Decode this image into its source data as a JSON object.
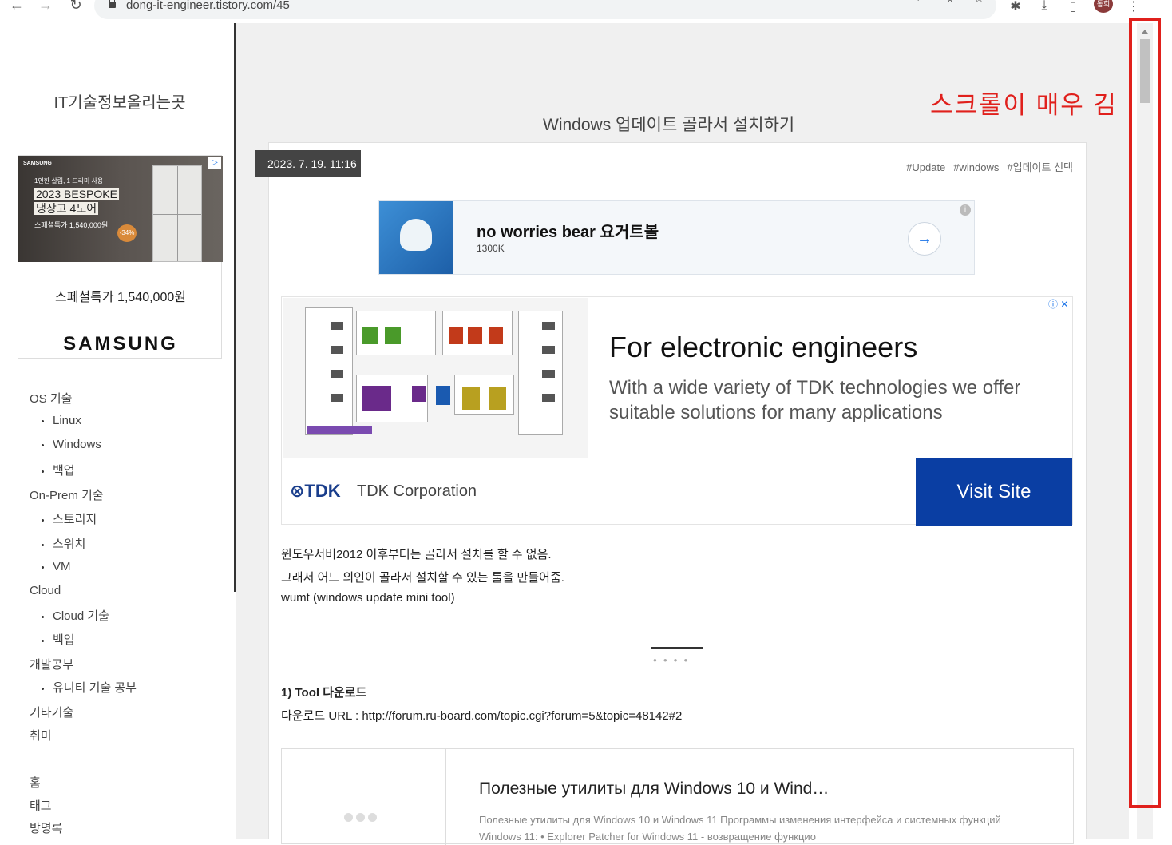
{
  "browser": {
    "url": "dong-it-engineer.tistory.com/45",
    "avatar_label": "동희"
  },
  "sidebar": {
    "blog_title": "IT기술정보올리는곳",
    "ad": {
      "brand": "SAMSUNG",
      "line1": "1인한 살림, 1 드리미 사용",
      "model": "2023 BESPOKE",
      "product": "냉장고 4도어",
      "price_line": "스페셜특가 1,540,000원",
      "discount": "-34%",
      "caption": "스페셜특가 1,540,000원",
      "logo": "SAMSUNG"
    },
    "categories": [
      {
        "label": "OS 기술",
        "children": [
          "Linux",
          "Windows",
          "백업"
        ]
      },
      {
        "label": "On-Prem 기술",
        "children": [
          "스토리지",
          "스위치",
          "VM"
        ]
      },
      {
        "label": "Cloud",
        "children": [
          "Cloud 기술",
          "백업"
        ]
      },
      {
        "label": "개발공부",
        "children": [
          "유니티 기술 공부"
        ]
      },
      {
        "label": "기타기술",
        "children": []
      },
      {
        "label": "취미",
        "children": []
      }
    ],
    "links": [
      "홈",
      "태그",
      "방명록"
    ]
  },
  "post": {
    "title": "Windows 업데이트 골라서 설치하기",
    "date": "2023. 7. 19. 11:16",
    "tags": [
      "#Update",
      "#windows",
      "#업데이트 선택"
    ],
    "paragraphs": [
      "윈도우서버2012 이후부터는 골라서 설치를 할 수 없음.",
      "그래서 어느 의인이 골라서 설치할 수 있는 툴을 만들어줌.",
      "wumt (windows update mini tool)"
    ],
    "section_heading": "1) Tool 다운로드",
    "download_line": "다운로드 URL : http://forum.ru-board.com/topic.cgi?forum=5&topic=48142#2"
  },
  "ad_banner": {
    "title": "no worries bear 요거트볼",
    "subtitle": "1300K",
    "arrow": "→",
    "info": "i"
  },
  "ad_tdk": {
    "headline": "For electronic engineers",
    "body": "With a wide variety of TDK technologies we offer suitable solutions for many applications",
    "brand": "⊗TDK",
    "company": "TDK Corporation",
    "button": "Visit Site",
    "icons": "ⓘ ✕"
  },
  "link_card": {
    "title": "Полезные утилиты для Windows 10 и Wind…",
    "description": "Полезные утилиты для Windows 10 и Windows 11 Программы изменения интерфейса и системных функций Windows 11: • Explorer Patcher for Windows 11 - возвращение функцио"
  },
  "annotation": {
    "text": "스크롤이 매우 김",
    "color": "#e0201c"
  }
}
